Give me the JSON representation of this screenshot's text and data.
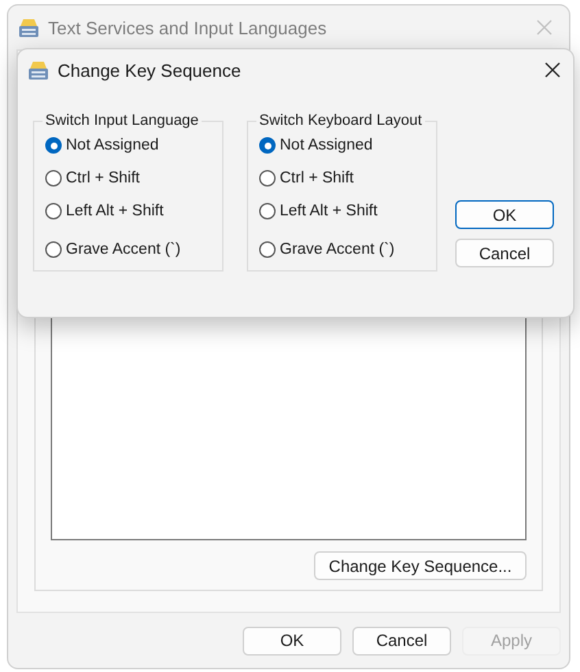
{
  "window": {
    "title": "Text Services and Input Languages",
    "list_panel": {
      "button": "Change Key Sequence..."
    },
    "buttons": [
      {
        "label": "OK",
        "disabled": false
      },
      {
        "label": "Cancel",
        "disabled": false
      },
      {
        "label": "Apply",
        "disabled": true
      }
    ]
  },
  "dialog": {
    "title": "Change Key Sequence",
    "groups": [
      {
        "title": "Switch Input Language",
        "options": [
          {
            "label": "Not Assigned",
            "selected": true
          },
          {
            "label": "Ctrl + Shift",
            "selected": false
          },
          {
            "label": "Left Alt + Shift",
            "selected": false
          },
          {
            "label": "Grave Accent (`)",
            "selected": false
          }
        ]
      },
      {
        "title": "Switch Keyboard Layout",
        "options": [
          {
            "label": "Not Assigned",
            "selected": true
          },
          {
            "label": "Ctrl + Shift",
            "selected": false
          },
          {
            "label": "Left Alt + Shift",
            "selected": false
          },
          {
            "label": "Grave Accent (`)",
            "selected": false
          }
        ]
      }
    ],
    "buttons": [
      {
        "label": "OK",
        "default": true
      },
      {
        "label": "Cancel",
        "default": false
      }
    ]
  }
}
